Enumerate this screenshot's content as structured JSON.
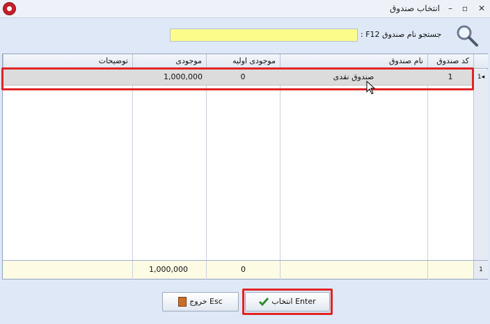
{
  "window": {
    "title": "انتخاب صندوق",
    "min_glyph": "–",
    "max_glyph": "▫",
    "close_glyph": "✕"
  },
  "search": {
    "label": "جستجو نام صندوق F12 :",
    "value": ""
  },
  "grid": {
    "columns": [
      "کد صندوق",
      "نام صندوق",
      "موجودی اولیه",
      "موجودی",
      "توضیحات"
    ],
    "rows": [
      {
        "indicator": "1",
        "code": "1",
        "name": "صندوق نقدی",
        "initial": "0",
        "balance": "1,000,000",
        "desc": ""
      }
    ],
    "footer": {
      "indicator": "1",
      "initial": "0",
      "balance": "1,000,000"
    }
  },
  "buttons": {
    "exit_label": "خروج Esc",
    "select_label": "انتخاب Enter"
  },
  "colors": {
    "highlight": "#e02424",
    "search_bg": "#fcfc8a"
  }
}
